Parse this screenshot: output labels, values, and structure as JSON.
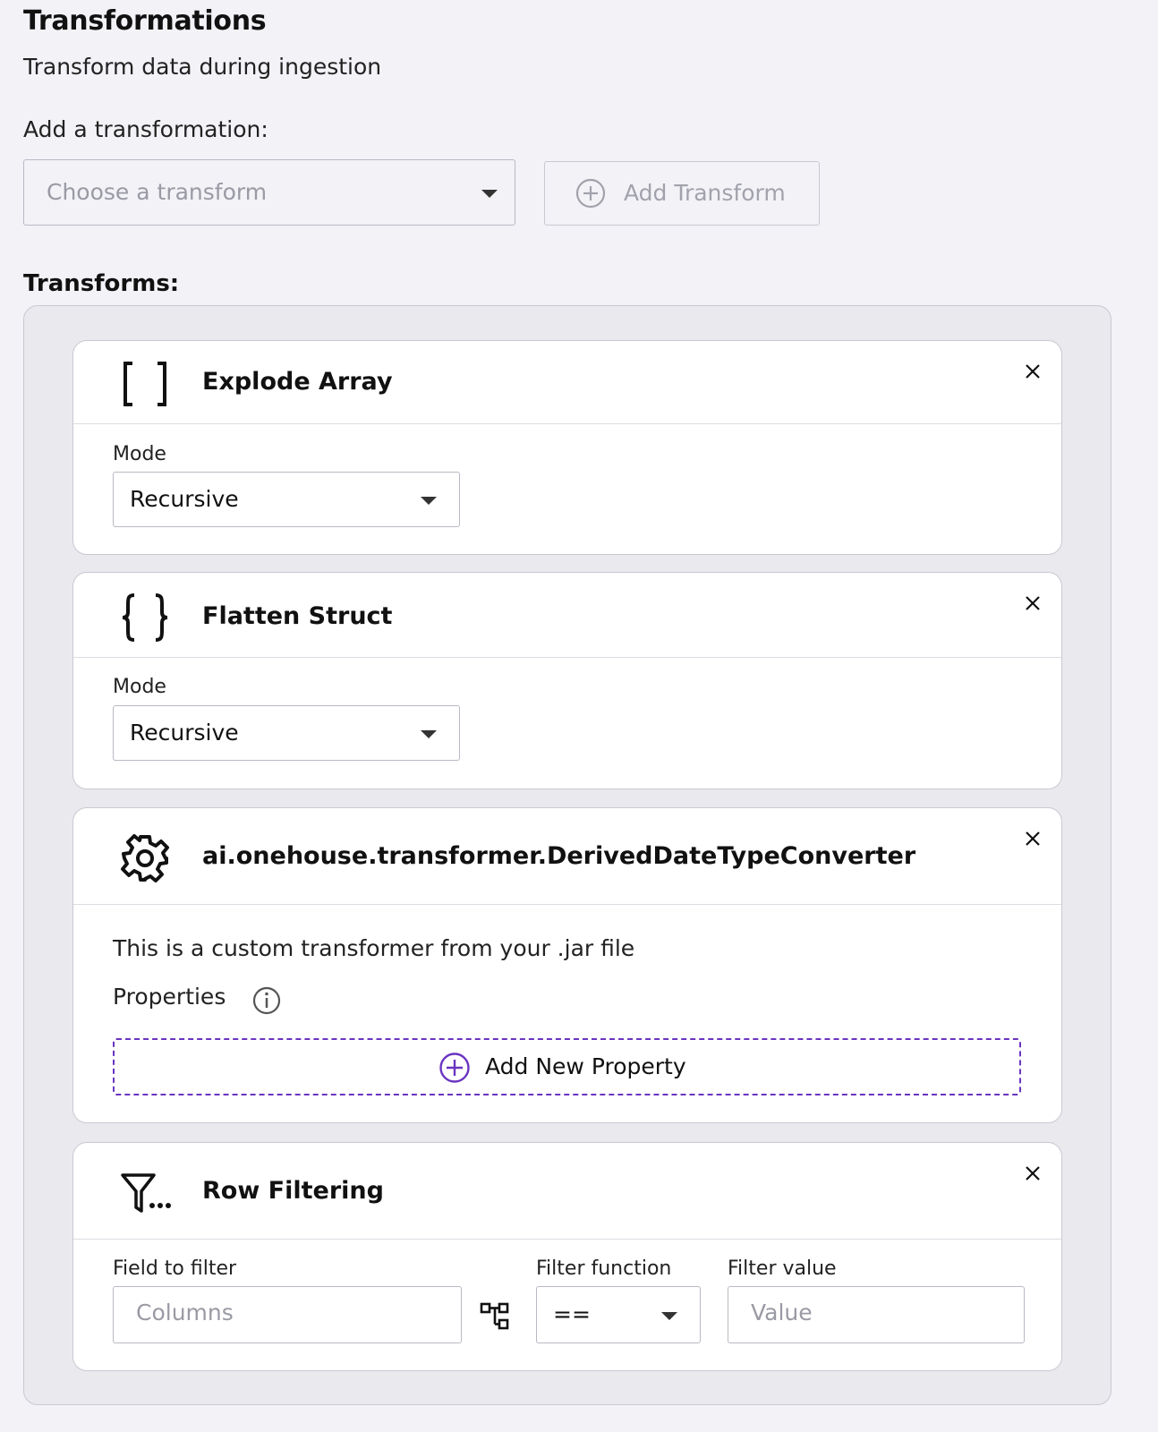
{
  "header": {
    "title": "Transformations",
    "subtitle": "Transform data during ingestion"
  },
  "add_section": {
    "label": "Add a transformation:",
    "select_placeholder": "Choose a transform",
    "add_button_label": "Add Transform"
  },
  "transforms_label": "Transforms:",
  "cards": {
    "explode": {
      "title": "Explode Array",
      "icon": "brackets-icon",
      "mode_label": "Mode",
      "mode_value": "Recursive"
    },
    "flatten": {
      "title": "Flatten Struct",
      "icon": "braces-icon",
      "mode_label": "Mode",
      "mode_value": "Recursive"
    },
    "custom": {
      "title": "ai.onehouse.transformer.DerivedDateTypeConverter",
      "icon": "gear-icon",
      "description": "This is a custom transformer from your .jar file",
      "properties_label": "Properties",
      "add_property_label": "Add New Property"
    },
    "filter": {
      "title": "Row Filtering",
      "icon": "filter-icon",
      "field_label": "Field to filter",
      "field_placeholder": "Columns",
      "function_label": "Filter function",
      "function_value": "==",
      "value_label": "Filter value",
      "value_placeholder": "Value"
    }
  },
  "colors": {
    "background": "#f2f2f7",
    "accent": "#6a34c0",
    "border": "#c9c9d2"
  }
}
